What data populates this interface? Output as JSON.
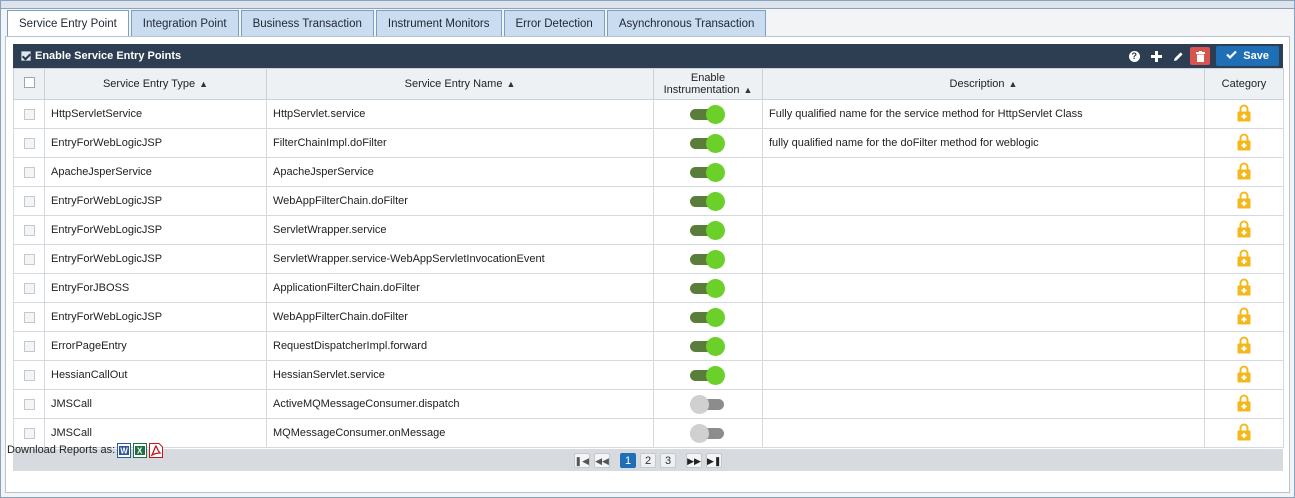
{
  "tabs": [
    {
      "label": "Service Entry Point",
      "active": true
    },
    {
      "label": "Integration Point",
      "active": false
    },
    {
      "label": "Business Transaction",
      "active": false
    },
    {
      "label": "Instrument Monitors",
      "active": false
    },
    {
      "label": "Error Detection",
      "active": false
    },
    {
      "label": "Asynchronous Transaction",
      "active": false
    }
  ],
  "toolbar": {
    "enable_label": "Enable Service Entry Points",
    "enable_checked": true,
    "help_icon": "question-circle-icon",
    "add_icon": "plus-icon",
    "edit_icon": "pencil-icon",
    "delete_icon": "trash-icon",
    "save_label": "Save"
  },
  "table": {
    "headers": {
      "type": "Service Entry Type",
      "name": "Service Entry Name",
      "enable_line1": "Enable",
      "enable_line2": "Instrumentation",
      "description": "Description",
      "category": "Category"
    },
    "rows": [
      {
        "type": "HttpServletService",
        "name": "HttpServlet.service",
        "enabled": true,
        "description": "Fully qualified name for the service method for HttpServlet Class"
      },
      {
        "type": "EntryForWebLogicJSP",
        "name": "FilterChainImpl.doFilter",
        "enabled": true,
        "description": "fully qualified name for the doFilter method for weblogic"
      },
      {
        "type": "ApacheJsperService",
        "name": "ApacheJsperService",
        "enabled": true,
        "description": ""
      },
      {
        "type": "EntryForWebLogicJSP",
        "name": "WebAppFilterChain.doFilter",
        "enabled": true,
        "description": ""
      },
      {
        "type": "EntryForWebLogicJSP",
        "name": "ServletWrapper.service",
        "enabled": true,
        "description": ""
      },
      {
        "type": "EntryForWebLogicJSP",
        "name": "ServletWrapper.service-WebAppServletInvocationEvent",
        "enabled": true,
        "description": ""
      },
      {
        "type": "EntryForJBOSS",
        "name": "ApplicationFilterChain.doFilter",
        "enabled": true,
        "description": ""
      },
      {
        "type": "EntryForWebLogicJSP",
        "name": "WebAppFilterChain.doFilter",
        "enabled": true,
        "description": ""
      },
      {
        "type": "ErrorPageEntry",
        "name": "RequestDispatcherImpl.forward",
        "enabled": true,
        "description": ""
      },
      {
        "type": "HessianCallOut",
        "name": "HessianServlet.service",
        "enabled": true,
        "description": ""
      },
      {
        "type": "JMSCall",
        "name": "ActiveMQMessageConsumer.dispatch",
        "enabled": false,
        "description": ""
      },
      {
        "type": "JMSCall",
        "name": "MQMessageConsumer.onMessage",
        "enabled": false,
        "description": ""
      }
    ],
    "category_icon": "lock-icon"
  },
  "pagination": {
    "pages": [
      "1",
      "2",
      "3"
    ],
    "current": "1"
  },
  "downloads": {
    "label": "Download Reports as:",
    "formats": [
      "word-icon",
      "excel-icon",
      "pdf-icon"
    ]
  },
  "colors": {
    "toolbar_bg": "#2d3d52",
    "save_button": "#1f6fb6",
    "delete_button": "#d9534f",
    "toggle_on": "#6bd12a",
    "lock": "#f5b81c",
    "tab_bg": "#c9dcf0"
  }
}
